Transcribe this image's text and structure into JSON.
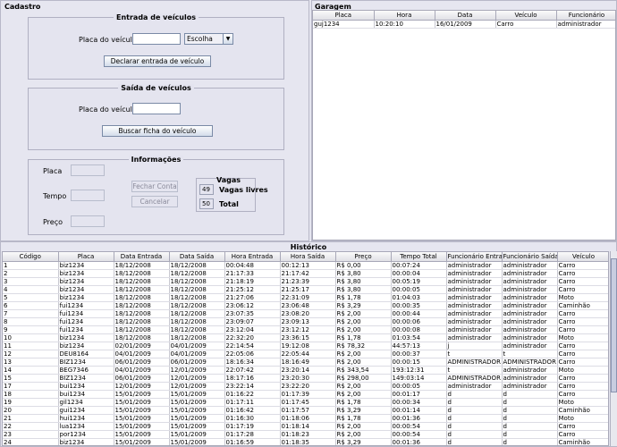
{
  "cadastro": {
    "title": "Cadastro",
    "entrada": {
      "title": "Entrada de veículos",
      "placa_label": "Placa do veículo",
      "placa_value": "",
      "tipo_selected": "Escolha",
      "button": "Declarar entrada de veículo"
    },
    "saida": {
      "title": "Saída de veículos",
      "placa_label": "Placa do veículo",
      "placa_value": "",
      "button": "Buscar ficha do veículo"
    },
    "info": {
      "title": "Informações",
      "placa_label": "Placa",
      "tempo_label": "Tempo",
      "preco_label": "Preço",
      "fechar_button": "Fechar Conta",
      "cancelar_button": "Cancelar",
      "vagas": {
        "title": "Vagas",
        "livres_value": "49",
        "livres_label": "Vagas livres",
        "total_value": "50",
        "total_label": "Total"
      }
    }
  },
  "garagem": {
    "title": "Garagem",
    "columns": [
      "Placa",
      "Hora",
      "Data",
      "Veículo",
      "Funcionário"
    ],
    "rows": [
      [
        "guj1234",
        "10:20:10",
        "16/01/2009",
        "Carro",
        "administrador"
      ]
    ]
  },
  "historico": {
    "title": "Histórico",
    "columns": [
      "Código",
      "Placa",
      "Data Entrada",
      "Data Saída",
      "Hora Entrada",
      "Hora Saída",
      "Preço",
      "Tempo Total",
      "Funcionário Entrada",
      "Funcionário Saída",
      "Veículo"
    ],
    "rows": [
      [
        "1",
        "biz1234",
        "18/12/2008",
        "18/12/2008",
        "00:04:48",
        "00:12:13",
        "R$ 0,00",
        "00:07:24",
        "administrador",
        "administrador",
        "Carro"
      ],
      [
        "2",
        "biz1234",
        "18/12/2008",
        "18/12/2008",
        "21:17:33",
        "21:17:42",
        "R$ 3,80",
        "00:00:04",
        "administrador",
        "administrador",
        "Carro"
      ],
      [
        "3",
        "biz1234",
        "18/12/2008",
        "18/12/2008",
        "21:18:19",
        "21:23:39",
        "R$ 3,80",
        "00:05:19",
        "administrador",
        "administrador",
        "Carro"
      ],
      [
        "4",
        "biz1234",
        "18/12/2008",
        "18/12/2008",
        "21:25:12",
        "21:25:17",
        "R$ 3,80",
        "00:00:05",
        "administrador",
        "administrador",
        "Carro"
      ],
      [
        "5",
        "biz1234",
        "18/12/2008",
        "18/12/2008",
        "21:27:06",
        "22:31:09",
        "R$ 1,78",
        "01:04:03",
        "administrador",
        "administrador",
        "Moto"
      ],
      [
        "6",
        "fui1234",
        "18/12/2008",
        "18/12/2008",
        "23:06:12",
        "23:06:48",
        "R$ 3,29",
        "00:00:35",
        "administrador",
        "administrador",
        "Caminhão"
      ],
      [
        "7",
        "fui1234",
        "18/12/2008",
        "18/12/2008",
        "23:07:35",
        "23:08:20",
        "R$ 2,00",
        "00:00:44",
        "administrador",
        "administrador",
        "Carro"
      ],
      [
        "8",
        "fui1234",
        "18/12/2008",
        "18/12/2008",
        "23:09:07",
        "23:09:13",
        "R$ 2,00",
        "00:00:06",
        "administrador",
        "administrador",
        "Carro"
      ],
      [
        "9",
        "fui1234",
        "18/12/2008",
        "18/12/2008",
        "23:12:04",
        "23:12:12",
        "R$ 2,00",
        "00:00:08",
        "administrador",
        "administrador",
        "Carro"
      ],
      [
        "10",
        "biz1234",
        "18/12/2008",
        "18/12/2008",
        "22:32:20",
        "23:36:15",
        "R$ 1,78",
        "01:03:54",
        "administrador",
        "administrador",
        "Moto"
      ],
      [
        "11",
        "biz1234",
        "02/01/2009",
        "04/01/2009",
        "22:14:54",
        "19:12:08",
        "R$ 78,32",
        "44:57:13",
        "j",
        "administrador",
        "Carro"
      ],
      [
        "12",
        "DEU8164",
        "04/01/2009",
        "04/01/2009",
        "22:05:06",
        "22:05:44",
        "R$ 2,00",
        "00:00:37",
        "t",
        "t",
        "Carro"
      ],
      [
        "13",
        "BIZ1234",
        "06/01/2009",
        "06/01/2009",
        "18:16:34",
        "18:16:49",
        "R$ 2,00",
        "00:00:15",
        "ADMINISTRADOR",
        "ADMINISTRADOR",
        "Carro"
      ],
      [
        "14",
        "BEG7346",
        "04/01/2009",
        "12/01/2009",
        "22:07:42",
        "23:20:14",
        "R$ 343,54",
        "193:12:31",
        "t",
        "administrador",
        "Moto"
      ],
      [
        "15",
        "BIZ1234",
        "06/01/2009",
        "12/01/2009",
        "18:17:16",
        "23:20:30",
        "R$ 298,00",
        "149:03:14",
        "ADMINISTRADOR",
        "administrador",
        "Carro"
      ],
      [
        "17",
        "bui1234",
        "12/01/2009",
        "12/01/2009",
        "23:22:14",
        "23:22:20",
        "R$ 2,00",
        "00:00:05",
        "administrador",
        "administrador",
        "Carro"
      ],
      [
        "18",
        "bui1234",
        "15/01/2009",
        "15/01/2009",
        "01:16:22",
        "01:17:39",
        "R$ 2,00",
        "00:01:17",
        "d",
        "d",
        "Carro"
      ],
      [
        "19",
        "gil1234",
        "15/01/2009",
        "15/01/2009",
        "01:17:11",
        "01:17:45",
        "R$ 1,78",
        "00:00:34",
        "d",
        "d",
        "Moto"
      ],
      [
        "20",
        "gui1234",
        "15/01/2009",
        "15/01/2009",
        "01:16:42",
        "01:17:57",
        "R$ 3,29",
        "00:01:14",
        "d",
        "d",
        "Caminhão"
      ],
      [
        "21",
        "hui1234",
        "15/01/2009",
        "15/01/2009",
        "01:16:30",
        "01:18:06",
        "R$ 1,78",
        "00:01:36",
        "d",
        "d",
        "Moto"
      ],
      [
        "22",
        "lua1234",
        "15/01/2009",
        "15/01/2009",
        "01:17:19",
        "01:18:14",
        "R$ 2,00",
        "00:00:54",
        "d",
        "d",
        "Carro"
      ],
      [
        "23",
        "por1234",
        "15/01/2009",
        "15/01/2009",
        "01:17:28",
        "01:18:23",
        "R$ 2,00",
        "00:00:54",
        "d",
        "d",
        "Carro"
      ],
      [
        "24",
        "biz1234",
        "15/01/2009",
        "15/01/2009",
        "01:16:59",
        "01:18:35",
        "R$ 3,29",
        "00:01:36",
        "d",
        "d",
        "Caminhão"
      ]
    ]
  }
}
